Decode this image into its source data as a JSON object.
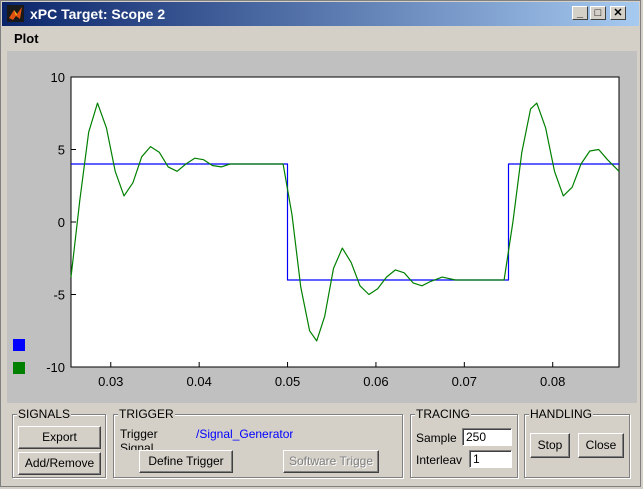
{
  "window": {
    "title": "xPC Target: Scope 2",
    "minimize_glyph": "_",
    "maximize_glyph": "□",
    "close_glyph": "✕"
  },
  "menu": {
    "items": [
      {
        "label": "Plot"
      }
    ]
  },
  "plot": {
    "background": "#ffffff",
    "frame_color": "#c0c0c0",
    "y_ticks": [
      "10",
      "5",
      "0",
      "-5",
      "-10"
    ],
    "x_ticks": [
      "0.03",
      "0.04",
      "0.05",
      "0.06",
      "0.07",
      "0.08"
    ],
    "legend_markers": [
      {
        "color": "#0000ff"
      },
      {
        "color": "#008000"
      }
    ]
  },
  "chart_data": {
    "type": "line",
    "xlim": [
      0.0255,
      0.0875
    ],
    "ylim": [
      -10,
      10
    ],
    "x_ticks": [
      0.03,
      0.04,
      0.05,
      0.06,
      0.07,
      0.08
    ],
    "y_ticks": [
      10,
      5,
      0,
      -5,
      -10
    ],
    "grid": false,
    "series": [
      {
        "color": "#0000ff",
        "points": [
          [
            0.0255,
            4
          ],
          [
            0.05,
            4
          ],
          [
            0.05,
            -4
          ],
          [
            0.075,
            -4
          ],
          [
            0.075,
            4
          ],
          [
            0.0875,
            4
          ]
        ]
      },
      {
        "color": "#008000",
        "points": [
          [
            0.0255,
            -3.8
          ],
          [
            0.0265,
            1.5
          ],
          [
            0.0275,
            6.2
          ],
          [
            0.0285,
            8.2
          ],
          [
            0.0295,
            6.5
          ],
          [
            0.0305,
            3.5
          ],
          [
            0.0315,
            1.8
          ],
          [
            0.0325,
            2.7
          ],
          [
            0.0335,
            4.5
          ],
          [
            0.0345,
            5.2
          ],
          [
            0.0355,
            4.8
          ],
          [
            0.0365,
            3.8
          ],
          [
            0.0375,
            3.5
          ],
          [
            0.0385,
            4.0
          ],
          [
            0.0395,
            4.4
          ],
          [
            0.0405,
            4.3
          ],
          [
            0.0415,
            3.9
          ],
          [
            0.0425,
            3.8
          ],
          [
            0.0435,
            4.0
          ],
          [
            0.0495,
            4.0
          ],
          [
            0.0505,
            0.5
          ],
          [
            0.0515,
            -4.5
          ],
          [
            0.0525,
            -7.5
          ],
          [
            0.0533,
            -8.2
          ],
          [
            0.0542,
            -6.5
          ],
          [
            0.0552,
            -3.2
          ],
          [
            0.0562,
            -1.8
          ],
          [
            0.0572,
            -2.8
          ],
          [
            0.0582,
            -4.4
          ],
          [
            0.0592,
            -5.0
          ],
          [
            0.0602,
            -4.6
          ],
          [
            0.0612,
            -3.8
          ],
          [
            0.0622,
            -3.3
          ],
          [
            0.0632,
            -3.5
          ],
          [
            0.0642,
            -4.2
          ],
          [
            0.0652,
            -4.4
          ],
          [
            0.0662,
            -4.1
          ],
          [
            0.0675,
            -3.8
          ],
          [
            0.069,
            -4.0
          ],
          [
            0.0745,
            -4.0
          ],
          [
            0.0755,
            0.0
          ],
          [
            0.0765,
            4.8
          ],
          [
            0.0775,
            7.8
          ],
          [
            0.0782,
            8.2
          ],
          [
            0.0792,
            6.5
          ],
          [
            0.0802,
            3.5
          ],
          [
            0.0812,
            1.8
          ],
          [
            0.0822,
            2.4
          ],
          [
            0.0832,
            4.0
          ],
          [
            0.0842,
            4.9
          ],
          [
            0.0852,
            5.0
          ],
          [
            0.0862,
            4.3
          ],
          [
            0.0875,
            3.5
          ]
        ]
      }
    ]
  },
  "signals": {
    "title": "SIGNALS",
    "export_label": "Export",
    "add_remove_label": "Add/Remove"
  },
  "trigger": {
    "title": "TRIGGER",
    "trigger_label": "Trigger",
    "trigger_value": "/Signal_Generator",
    "signal_label": "Signal",
    "define_label": "Define Trigger",
    "software_label": "Software Trigge"
  },
  "tracing": {
    "title": "TRACING",
    "samples_label": "Sample",
    "samples_value": "250",
    "interleave_label": "Interleav",
    "interleave_value": "1"
  },
  "handling": {
    "title": "HANDLING",
    "stop_label": "Stop",
    "close_label": "Close"
  }
}
